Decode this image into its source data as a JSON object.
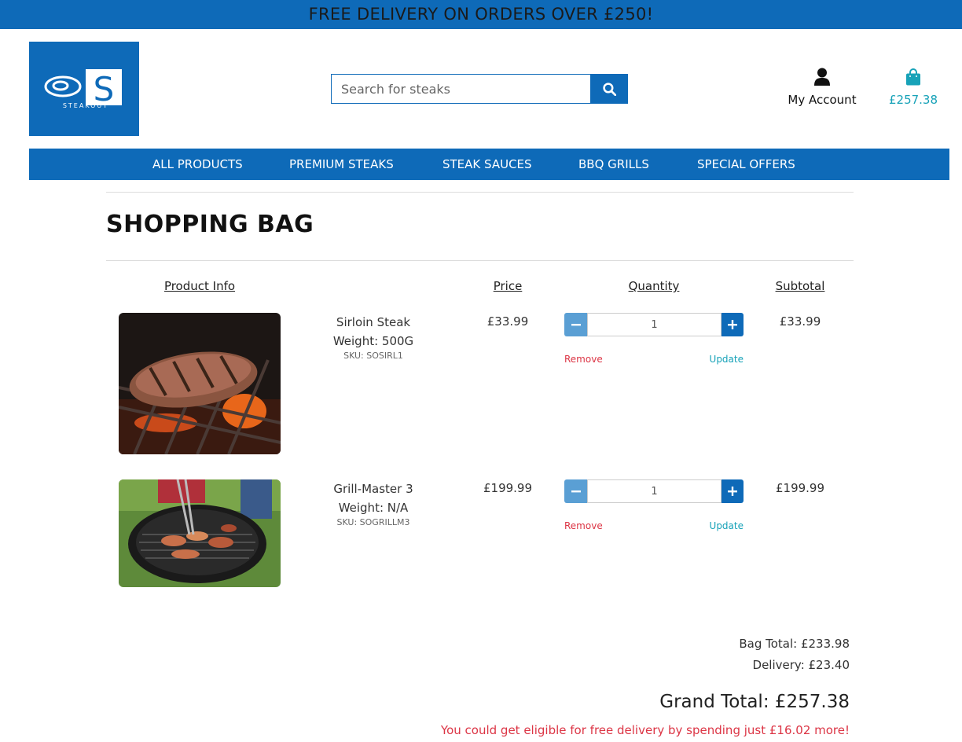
{
  "banner": {
    "text": "FREE DELIVERY ON ORDERS OVER £250!"
  },
  "logo": {
    "letter": "S",
    "text": "STEAKOUT"
  },
  "search": {
    "placeholder": "Search for steaks"
  },
  "account": {
    "label": "My Account"
  },
  "bag": {
    "total": "£257.38"
  },
  "nav": {
    "items": [
      "ALL PRODUCTS",
      "PREMIUM STEAKS",
      "STEAK SAUCES",
      "BBQ GRILLS",
      "SPECIAL OFFERS"
    ]
  },
  "page": {
    "title": "SHOPPING BAG"
  },
  "table": {
    "headers": {
      "product": "Product Info",
      "price": "Price",
      "quantity": "Quantity",
      "subtotal": "Subtotal"
    },
    "rows": [
      {
        "name": "Sirloin Steak",
        "weight": "Weight: 500G",
        "sku": "SKU: SOSIRL1",
        "price": "£33.99",
        "qty": "1",
        "subtotal": "£33.99",
        "remove": "Remove",
        "update": "Update"
      },
      {
        "name": "Grill-Master 3",
        "weight": "Weight: N/A",
        "sku": "SKU: SOGRILLM3",
        "price": "£199.99",
        "qty": "1",
        "subtotal": "£199.99",
        "remove": "Remove",
        "update": "Update"
      }
    ]
  },
  "totals": {
    "bag_total": "Bag Total: £233.98",
    "delivery": "Delivery: £23.40",
    "grand_total": "Grand Total: £257.38",
    "free_delivery_note": "You could get eligible for free delivery by spending just £16.02 more!"
  },
  "colors": {
    "brand": "#0e6ab8",
    "accent": "#17a2b8",
    "danger": "#dc3545"
  },
  "icons": {
    "search": "search-icon",
    "account": "user-icon",
    "bag": "shopping-bag-icon",
    "minus": "minus-icon",
    "plus": "plus-icon"
  }
}
